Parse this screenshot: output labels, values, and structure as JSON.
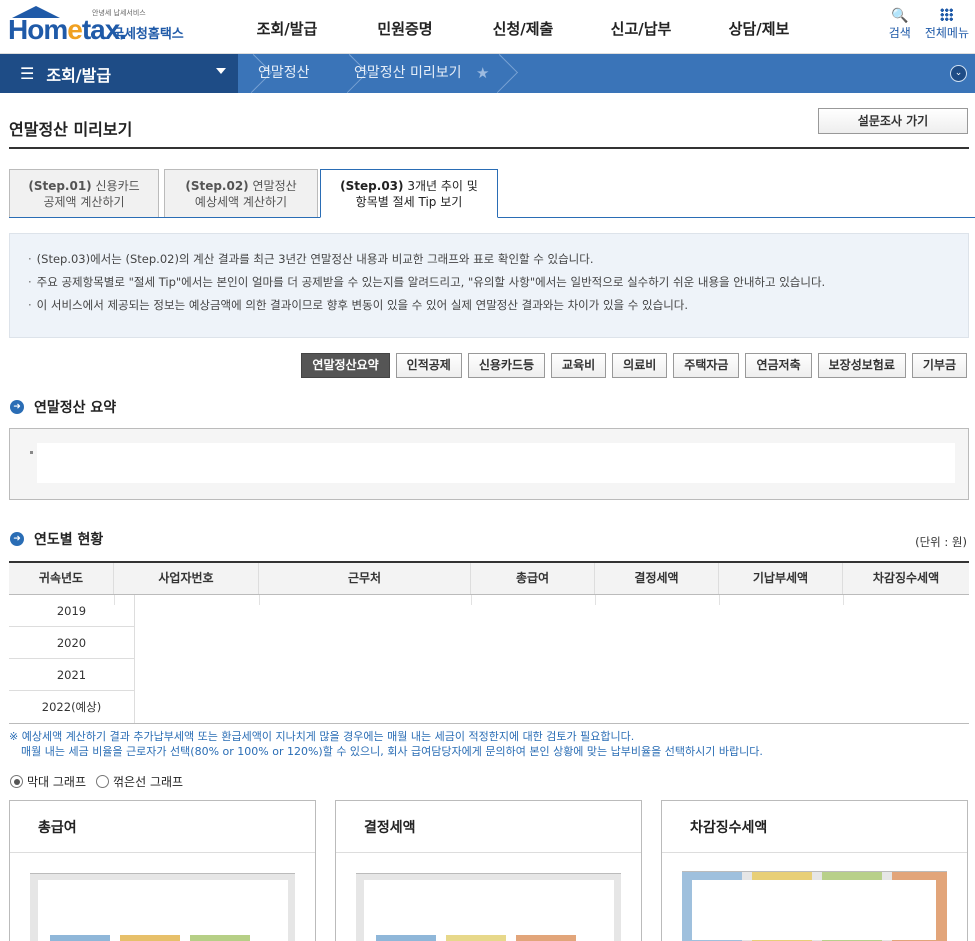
{
  "header": {
    "logo_text": "Hometax.",
    "logo_small": "안녕세 납세서비스",
    "logo_korean": "국세청홈택스",
    "menu": [
      "조회/발급",
      "민원증명",
      "신청/제출",
      "신고/납부",
      "상담/제보"
    ],
    "search_label": "검색",
    "all_menu_label": "전체메뉴"
  },
  "navbar": {
    "menu_title": "조회/발급",
    "crumbs": [
      "연말정산",
      "연말정산 미리보기"
    ]
  },
  "page": {
    "title": "연말정산 미리보기",
    "survey_button": "설문조사 가기"
  },
  "tabs": [
    {
      "step": "(Step.01)",
      "line1": "신용카드",
      "line2": "공제액 계산하기",
      "active": false
    },
    {
      "step": "(Step.02)",
      "line1": "연말정산",
      "line2": "예상세액 계산하기",
      "active": false
    },
    {
      "step": "(Step.03)",
      "line1": "3개년 추이 및",
      "line2": "항목별 절세 Tip 보기",
      "active": true
    }
  ],
  "info": [
    "(Step.03)에서는 (Step.02)의 계산 결과를 최근 3년간 연말정산 내용과 비교한 그래프와 표로 확인할 수 있습니다.",
    "주요 공제항목별로 \"절세 Tip\"에서는 본인이 얼마를 더 공제받을 수 있는지를 알려드리고, \"유의할 사항\"에서는 일반적으로 실수하기 쉬운 내용을 안내하고 있습니다.",
    "이 서비스에서 제공되는 정보는 예상금액에 의한 결과이므로 향후 변동이 있을 수 있어 실제 연말정산 결과와는 차이가 있을 수 있습니다."
  ],
  "categories": [
    "연말정산요약",
    "인적공제",
    "신용카드등",
    "교육비",
    "의료비",
    "주택자금",
    "연금저축",
    "보장성보험료",
    "기부금"
  ],
  "summary": {
    "heading": "연말정산 요약"
  },
  "yearly": {
    "heading": "연도별 현황",
    "unit": "(단위 : 원)",
    "columns": [
      "귀속년도",
      "사업자번호",
      "근무처",
      "총급여",
      "결정세액",
      "기납부세액",
      "차감징수세액"
    ],
    "rows": [
      "2019",
      "2020",
      "2021",
      "2022(예상)"
    ]
  },
  "notes": [
    "※ 예상세액 계산하기 결과 추가납부세액 또는 환급세액이 지나치게 많을 경우에는 매월 내는 세금이 적정한지에 대한 검토가 필요합니다.",
    "매월 내는 세금 비율을 근로자가 선택(80% or 100% or 120%)할 수 있으니, 회사 급여담당자에게 문의하여 본인 상황에 맞는 납부비율을 선택하시기 바랍니다."
  ],
  "graph_options": {
    "bar": "막대 그래프",
    "line": "꺾은선 그래프",
    "selected": "bar"
  },
  "cards": [
    "총급여",
    "결정세액",
    "차감징수세액"
  ],
  "colors": {
    "primary": "#2a6db5",
    "nav": "#3a74b8",
    "nav_dark": "#1e4c86",
    "info_bg": "#eef3f9"
  }
}
